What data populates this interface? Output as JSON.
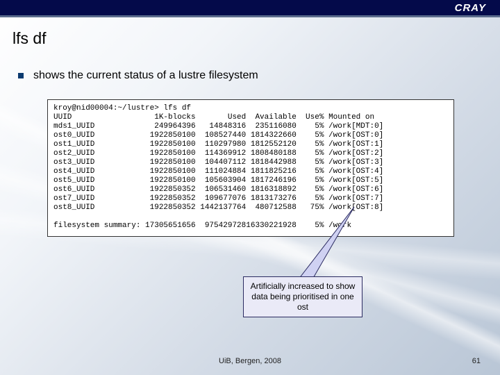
{
  "brand": {
    "logo_text": "CRAY"
  },
  "title": "lfs df",
  "bullet": "shows the current status of a lustre filesystem",
  "terminal": {
    "prompt": "kroy@nid00004:~/lustre> lfs df",
    "header": {
      "uuid": "UUID",
      "blocks": "1K-blocks",
      "used": "Used",
      "available": "Available",
      "usepct": "Use%",
      "mounted": "Mounted on"
    },
    "rows": [
      {
        "uuid": "mds1_UUID",
        "blocks": "249964396",
        "used": "14848316",
        "available": "235116080",
        "usepct": "5%",
        "mounted": "/work[MDT:0]"
      },
      {
        "uuid": "ost0_UUID",
        "blocks": "1922850100",
        "used": "108527440",
        "available": "1814322660",
        "usepct": "5%",
        "mounted": "/work[OST:0]"
      },
      {
        "uuid": "ost1_UUID",
        "blocks": "1922850100",
        "used": "110297980",
        "available": "1812552120",
        "usepct": "5%",
        "mounted": "/work[OST:1]"
      },
      {
        "uuid": "ost2_UUID",
        "blocks": "1922850100",
        "used": "114369912",
        "available": "1808480188",
        "usepct": "5%",
        "mounted": "/work[OST:2]"
      },
      {
        "uuid": "ost3_UUID",
        "blocks": "1922850100",
        "used": "104407112",
        "available": "1818442988",
        "usepct": "5%",
        "mounted": "/work[OST:3]"
      },
      {
        "uuid": "ost4_UUID",
        "blocks": "1922850100",
        "used": "111024884",
        "available": "1811825216",
        "usepct": "5%",
        "mounted": "/work[OST:4]"
      },
      {
        "uuid": "ost5_UUID",
        "blocks": "1922850100",
        "used": "105603904",
        "available": "1817246196",
        "usepct": "5%",
        "mounted": "/work[OST:5]"
      },
      {
        "uuid": "ost6_UUID",
        "blocks": "1922850352",
        "used": "106531460",
        "available": "1816318892",
        "usepct": "5%",
        "mounted": "/work[OST:6]"
      },
      {
        "uuid": "ost7_UUID",
        "blocks": "1922850352",
        "used": "109677076",
        "available": "1813173276",
        "usepct": "5%",
        "mounted": "/work[OST:7]"
      },
      {
        "uuid": "ost8_UUID",
        "blocks": "1922850352",
        "used": "1442137764",
        "available": "480712588",
        "usepct": "75%",
        "mounted": "/work[OST:8]"
      }
    ],
    "summary": {
      "label": "filesystem summary:",
      "blocks": "17305651656",
      "used": "975429728",
      "available": "16330221928",
      "usepct": "5%",
      "mounted": "/work"
    }
  },
  "callout": "Artificially increased to show data being prioritised in one ost",
  "footer": {
    "center": "UiB, Bergen, 2008",
    "page": "61"
  }
}
